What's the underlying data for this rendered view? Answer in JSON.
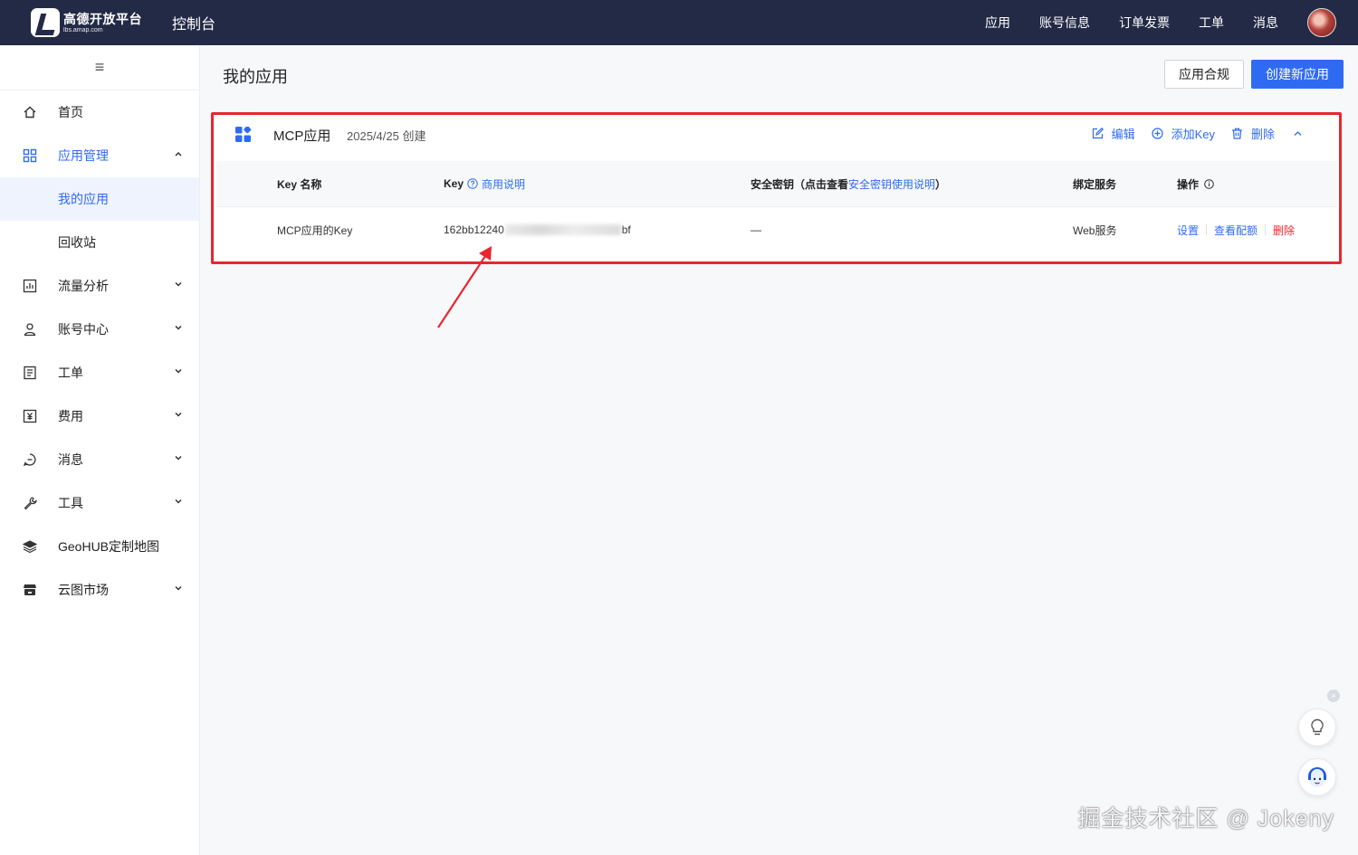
{
  "header": {
    "logo_title": "高德开放平台",
    "logo_sub": "lbs.amap.com",
    "console": "控制台",
    "nav": [
      "应用",
      "账号信息",
      "订单发票",
      "工单",
      "消息"
    ]
  },
  "sidebar": {
    "items": [
      {
        "label": "首页",
        "icon": "home-icon"
      },
      {
        "label": "应用管理",
        "icon": "apps-icon"
      },
      {
        "label": "我的应用"
      },
      {
        "label": "回收站"
      },
      {
        "label": "流量分析",
        "icon": "chart-icon"
      },
      {
        "label": "账号中心",
        "icon": "user-icon"
      },
      {
        "label": "工单",
        "icon": "ticket-icon"
      },
      {
        "label": "费用",
        "icon": "yuan-icon"
      },
      {
        "label": "消息",
        "icon": "message-icon"
      },
      {
        "label": "工具",
        "icon": "wrench-icon"
      },
      {
        "label": "GeoHUB定制地图",
        "icon": "layers-icon"
      },
      {
        "label": "云图市场",
        "icon": "store-icon"
      }
    ]
  },
  "main": {
    "title": "我的应用",
    "compliance_button": "应用合规",
    "create_button": "创建新应用"
  },
  "app": {
    "name": "MCP应用",
    "created": "2025/4/25 创建",
    "actions": {
      "edit": "编辑",
      "add_key": "添加Key",
      "delete": "删除"
    },
    "table": {
      "headers": {
        "key_name": "Key 名称",
        "key": "Key",
        "key_help": "商用说明",
        "secret_prefix": "安全密钥（点击查看",
        "secret_link": "安全密钥使用说明",
        "secret_suffix": "）",
        "service": "绑定服务",
        "ops": "操作"
      },
      "rows": [
        {
          "key_name": "MCP应用的Key",
          "key_start": "162bb12240",
          "key_end": "bf",
          "secret": "—",
          "service": "Web服务",
          "op_settings": "设置",
          "op_quota": "查看配额",
          "op_delete": "删除"
        }
      ]
    }
  },
  "watermark": "掘金技术社区 @ Jokeny",
  "colors": {
    "accent": "#2f6bf2",
    "topbar": "#232a46",
    "highlight": "#e8262e",
    "danger": "#f5222d"
  }
}
